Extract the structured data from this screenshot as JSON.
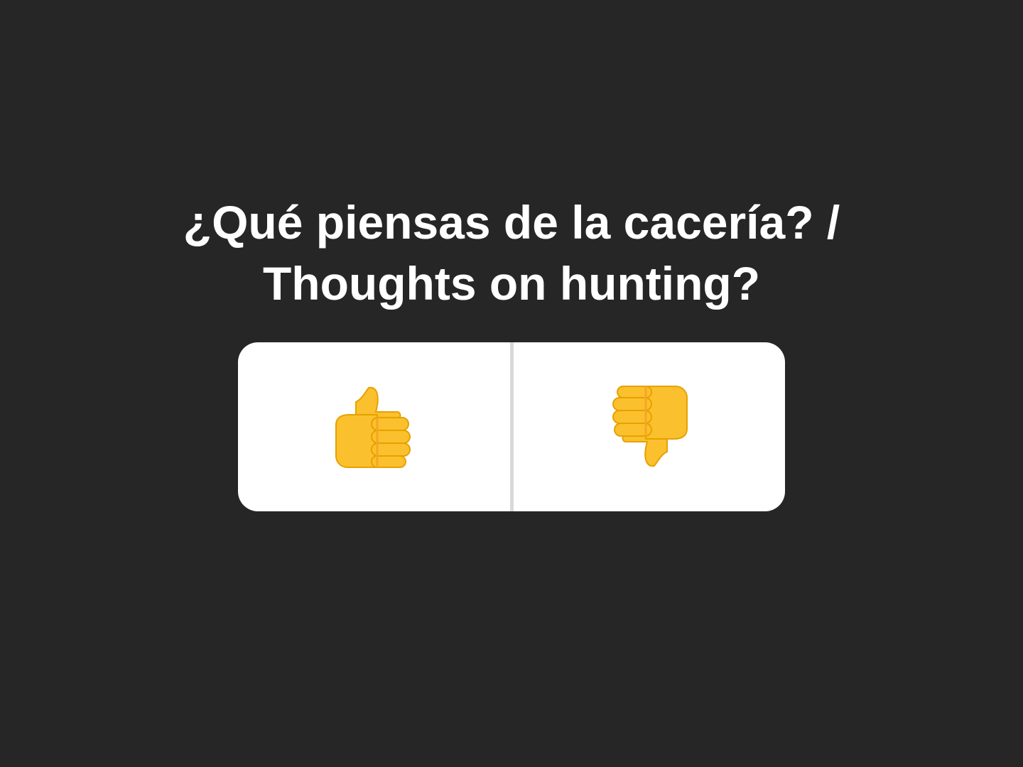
{
  "question": {
    "line1": "¿Qué piensas de la cacería? /",
    "line2": "Thoughts on hunting?"
  },
  "poll": {
    "options": [
      {
        "icon": "thumbs-up-icon",
        "emoji": "👍"
      },
      {
        "icon": "thumbs-down-icon",
        "emoji": "👎"
      }
    ]
  },
  "colors": {
    "background": "#262626",
    "text": "#ffffff",
    "card": "#ffffff",
    "divider": "#d9d9d9",
    "emoji_fill": "#FBC02D",
    "emoji_shade": "#F5A623"
  }
}
